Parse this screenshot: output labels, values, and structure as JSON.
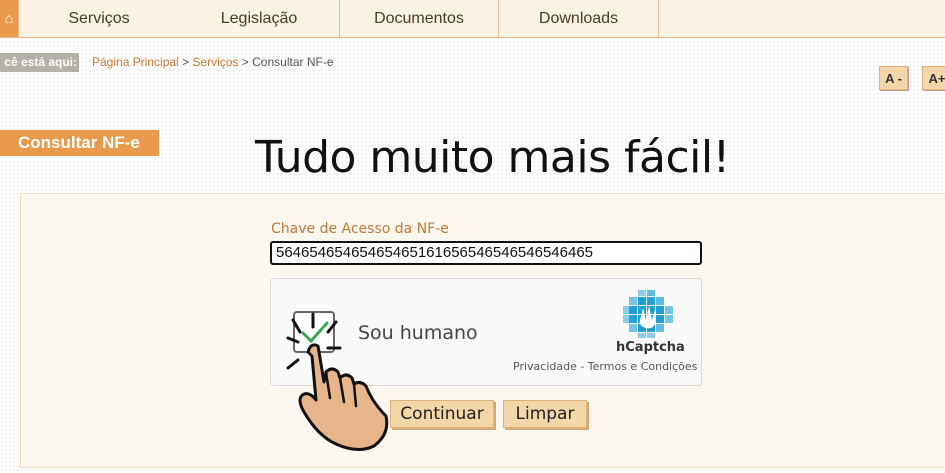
{
  "nav": {
    "home_glyph": "⌂",
    "tabs": [
      "Serviços",
      "Legislação",
      "Documentos",
      "Downloads"
    ]
  },
  "breadcrumb": {
    "label": "cê está aqui:",
    "home": "Página Principal",
    "separator": ">",
    "services": "Serviços",
    "current": "Consultar NF-e"
  },
  "font_controls": {
    "decrease": "A -",
    "increase": "A+"
  },
  "section": {
    "title": "Consultar NF-e"
  },
  "slogan": "Tudo muito mais fácil!",
  "form": {
    "access_key_label": "Chave de Acesso da NF-e",
    "access_key_value": "56465465465465465161656546546546546465"
  },
  "captcha": {
    "label": "Sou humano",
    "brand": "hCaptcha",
    "links": "Privacidade - Termos e Condições",
    "checked": true
  },
  "buttons": {
    "continue": "Continuar",
    "clear": "Limpar"
  },
  "colors": {
    "accent": "#e99a4c",
    "button_bg": "#f4d7a9",
    "label": "#c07a38",
    "hcaptcha_blue": "#1fa0d8",
    "hand": "#e8b48a"
  }
}
